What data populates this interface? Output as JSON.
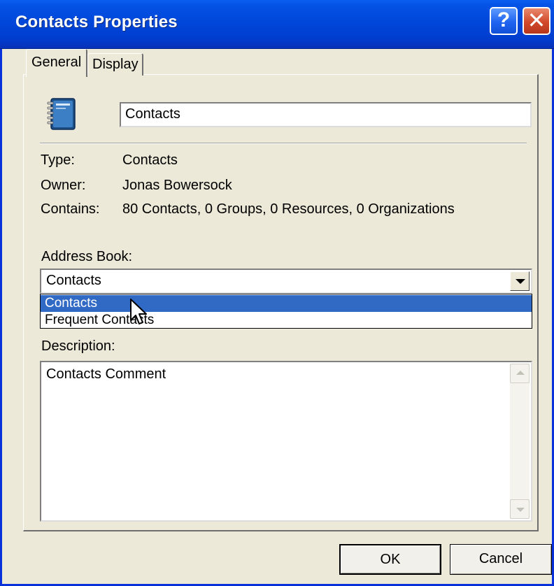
{
  "window": {
    "title": "Contacts Properties",
    "help_glyph": "?",
    "close_glyph": "✕"
  },
  "tabs": [
    {
      "label": "General",
      "active": true
    },
    {
      "label": "Display",
      "active": false
    }
  ],
  "general": {
    "name_value": "Contacts",
    "icon": "address-book-icon",
    "properties": [
      {
        "label": "Type:",
        "value": "Contacts"
      },
      {
        "label": "Owner:",
        "value": "Jonas Bowersock"
      },
      {
        "label": "Contains:",
        "value": "80 Contacts, 0 Groups, 0 Resources, 0 Organizations"
      }
    ],
    "address_book": {
      "label": "Address Book:",
      "selected": "Contacts",
      "options": [
        "Contacts",
        "Frequent Contacts"
      ],
      "highlighted_index": 0
    },
    "description": {
      "label": "Description:",
      "value": "Contacts Comment"
    }
  },
  "buttons": {
    "ok_label": "OK",
    "cancel_label": "Cancel"
  },
  "colors": {
    "titlebar": "#0047d9",
    "selection": "#316ac5",
    "dialog_bg": "#ece9d8"
  }
}
